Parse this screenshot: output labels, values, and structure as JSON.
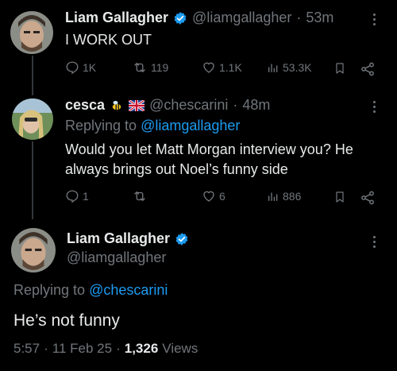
{
  "tweet1": {
    "display_name": "Liam Gallagher",
    "handle": "@liamgallagher",
    "separator": "·",
    "time": "53m",
    "text": "I WORK OUT",
    "stats": {
      "replies": "1K",
      "reposts": "119",
      "likes": "1.1K",
      "views": "53.3K"
    }
  },
  "tweet2": {
    "display_name": "cesca",
    "handle": "@chescarini",
    "separator": "·",
    "time": "48m",
    "replying_label": "Replying to",
    "replying_to": "@liamgallagher",
    "text_line1": "Would you let Matt Morgan interview you? He",
    "text_line2": "always brings out Noel’s funny side",
    "stats": {
      "replies": "1",
      "reposts": "",
      "likes": "6",
      "views": "886"
    }
  },
  "tweet3": {
    "display_name": "Liam Gallagher",
    "handle": "@liamgallagher",
    "replying_label": "Replying to",
    "replying_to": "@chescarini",
    "text": "He’s not funny",
    "time": "5:57",
    "date": "11 Feb 25",
    "views_count": "1,326",
    "views_label": "Views",
    "dot": "·"
  },
  "colors": {
    "accent": "#1d9bf0",
    "muted": "#71767b",
    "text": "#e7e9ea",
    "background": "#000000"
  }
}
